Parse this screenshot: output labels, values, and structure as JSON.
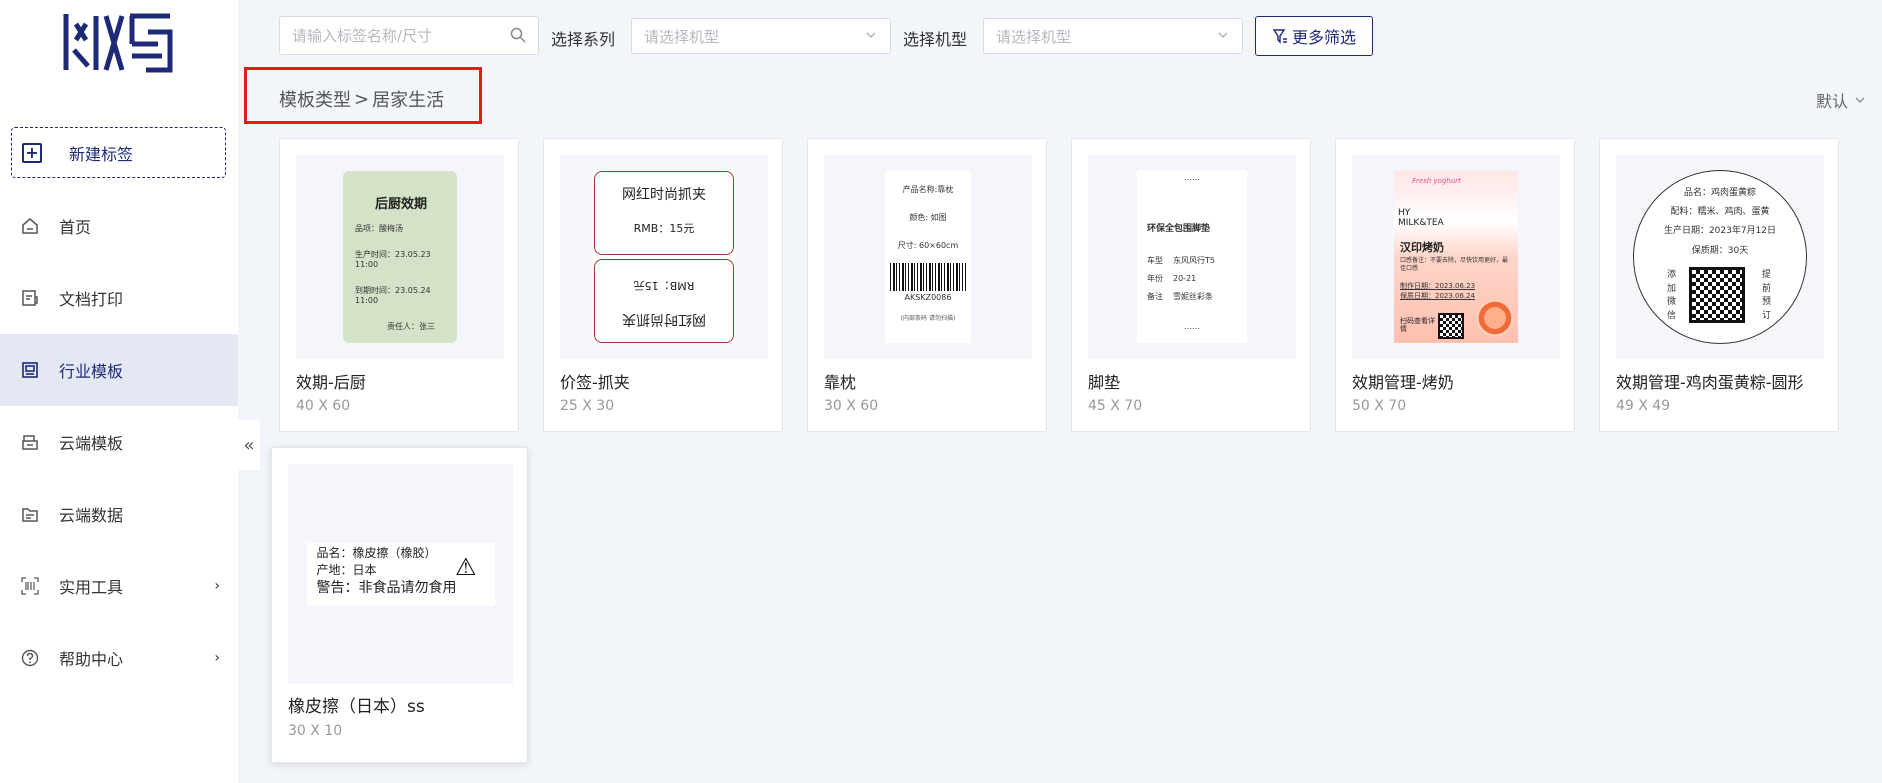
{
  "sidebar": {
    "new_label": "新建标签",
    "items": [
      {
        "label": "首页",
        "icon": "home-icon"
      },
      {
        "label": "文档打印",
        "icon": "document-icon"
      },
      {
        "label": "行业模板",
        "icon": "template-icon"
      },
      {
        "label": "云端模板",
        "icon": "cloud-template-icon"
      },
      {
        "label": "云端数据",
        "icon": "cloud-data-icon"
      },
      {
        "label": "实用工具",
        "icon": "barcode-tool-icon"
      },
      {
        "label": "帮助中心",
        "icon": "help-icon"
      }
    ],
    "collapse": "«"
  },
  "toolbar": {
    "search_placeholder": "请输入标签名称/尺寸",
    "series_label": "选择系列",
    "series_placeholder": "请选择机型",
    "model_label": "选择机型",
    "model_placeholder": "请选择机型",
    "more_filter": "更多筛选"
  },
  "breadcrumb": {
    "root": "模板类型",
    "separator": ">",
    "current": "居家生活"
  },
  "sort": {
    "label": "默认"
  },
  "templates": [
    {
      "name": "效期-后厨",
      "size": "40 X 60",
      "preview": {
        "title": "后厨效期",
        "l1": "品项：",
        "v1": "酸梅汤",
        "l2": "生产时间：",
        "v2": "23.05.23 11:00",
        "l3": "到期时间：",
        "v3": "23.05.24 11:00",
        "l4": "责任人：",
        "v4": "张三"
      }
    },
    {
      "name": "价签-抓夹",
      "size": "25 X 30",
      "preview": {
        "title": "网红时尚抓夹",
        "price": "RMB：15元"
      }
    },
    {
      "name": "靠枕",
      "size": "30 X 60",
      "preview": {
        "l1": "产品名称:靠枕",
        "l2": "颜色: 如图",
        "l3": "尺寸: 60×60cm",
        "code": "AKSKZ0086",
        "note": "(内部条码 请勿扫描)"
      }
    },
    {
      "name": "脚垫",
      "size": "45 X 70",
      "preview": {
        "top": "......",
        "title": "环保全包围脚垫",
        "k1": "车型",
        "v1": "东风风行T5",
        "k2": "年份",
        "v2": "20-21",
        "k3": "备注",
        "v3": "雪妮丝彩条",
        "bottom": "......"
      }
    },
    {
      "name": "效期管理-烤奶",
      "size": "50 X 70",
      "preview": {
        "script": "Fresh yoghurt",
        "brand": "HY MILK&TEA",
        "title": "汉印烤奶",
        "desc": "口感备注：不要去除，尽快饮用更好，最佳口感",
        "d1": "制作日期：2023.06.23",
        "d2": "保质日期：2023.06.24",
        "scan": "扫码查看详情"
      }
    },
    {
      "name": "效期管理-鸡肉蛋黄粽-圆形",
      "size": "49 X 49",
      "preview": {
        "l1": "品名：鸡肉蛋黄粽",
        "l2": "配料：糯米、鸡肉、蛋黄",
        "l3": "生产日期：2023年7月12日",
        "l4": "保质期：30天",
        "left": "添加微信",
        "right": "提前预订"
      }
    },
    {
      "name": "橡皮擦（日本）ss",
      "size": "30 X 10",
      "preview": {
        "l1": "品名：橡皮擦（橡胶）",
        "l2": "产地：日本",
        "l3": "警告：非食品请勿食用",
        "warn": "⚠"
      }
    }
  ]
}
